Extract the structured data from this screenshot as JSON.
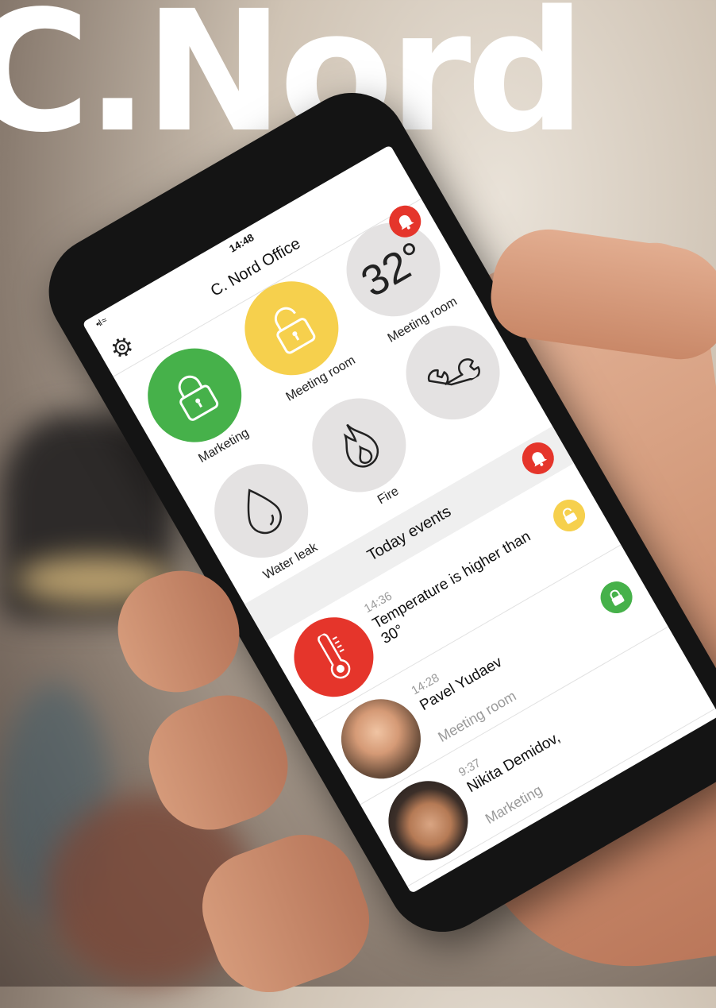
{
  "brand": {
    "text": "C.Nord"
  },
  "status_bar": {
    "time": "14:48",
    "signal": "•ıl ≈"
  },
  "app": {
    "title": "C. Nord Office",
    "tiles": [
      {
        "label": "Marketing",
        "icon": "lock-closed-icon",
        "color": "#46b14a"
      },
      {
        "label": "Meeting room",
        "icon": "lock-open-icon",
        "color": "#f6d04d"
      },
      {
        "label": "Meeting room",
        "value": "32°",
        "icon": "bell-icon"
      },
      {
        "label": "Water leak",
        "icon": "water-drop-icon"
      },
      {
        "label": "Fire",
        "icon": "fire-icon"
      },
      {
        "label": "",
        "icon": "wrench-icon"
      }
    ],
    "events_header": "Today events",
    "events": [
      {
        "time": "14:36",
        "title": "Temperature is higher than 30°",
        "subtitle": "",
        "avatar": "thermometer-icon",
        "badge": "lock-open-icon",
        "badge_color": "#f6d04d"
      },
      {
        "time": "14:28",
        "title": "Pavel Yudaev",
        "subtitle": "Meeting room",
        "avatar": "photo",
        "badge": "lock-closed-icon",
        "badge_color": "#46b14a"
      },
      {
        "time": "9:37",
        "title": "Nikita Demidov,",
        "subtitle": "Marketing",
        "avatar": "photo",
        "badge": "",
        "badge_color": ""
      }
    ]
  },
  "colors": {
    "alert_red": "#e5352b",
    "green": "#46b14a",
    "yellow": "#f6d04d"
  }
}
